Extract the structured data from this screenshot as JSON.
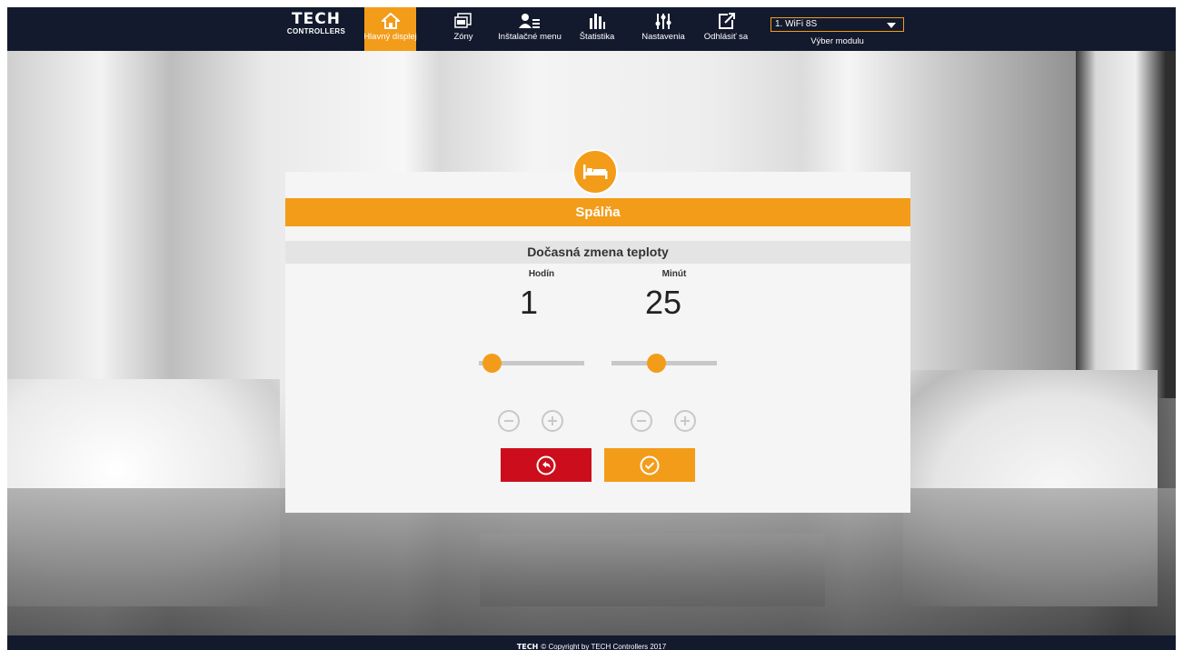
{
  "brand": {
    "logo_text": "TECH",
    "logo_subtext": "CONTROLLERS"
  },
  "nav": [
    {
      "label": "Hlavný displej",
      "icon": "home-icon",
      "active": true
    },
    {
      "label": "Zóny",
      "icon": "zones-icon",
      "active": false
    },
    {
      "label": "Inštalačné menu",
      "icon": "installer-icon",
      "active": false
    },
    {
      "label": "Štatistika",
      "icon": "statistics-icon",
      "active": false
    },
    {
      "label": "Nastavenia",
      "icon": "settings-icon",
      "active": false
    },
    {
      "label": "Odhlásiť sa",
      "icon": "logout-icon",
      "active": false
    }
  ],
  "module": {
    "selected": "1. WiFi 8S",
    "label": "Výber modulu"
  },
  "dialog": {
    "zone_name": "Spálňa",
    "zone_icon": "bed-icon",
    "title": "Dočasná zmena teploty",
    "hours": {
      "label": "Hodín",
      "value": "1",
      "slider_fraction": 0.12
    },
    "minutes": {
      "label": "Minút",
      "value": "25",
      "slider_fraction": 0.42
    },
    "back_icon": "undo-icon",
    "confirm_icon": "check-icon"
  },
  "footer": {
    "brand": "TECH",
    "text": "© Copyright by TECH Controllers 2017"
  },
  "colors": {
    "accent": "#f39c19",
    "topbar": "#131a2e",
    "danger": "#cc0d1b"
  }
}
